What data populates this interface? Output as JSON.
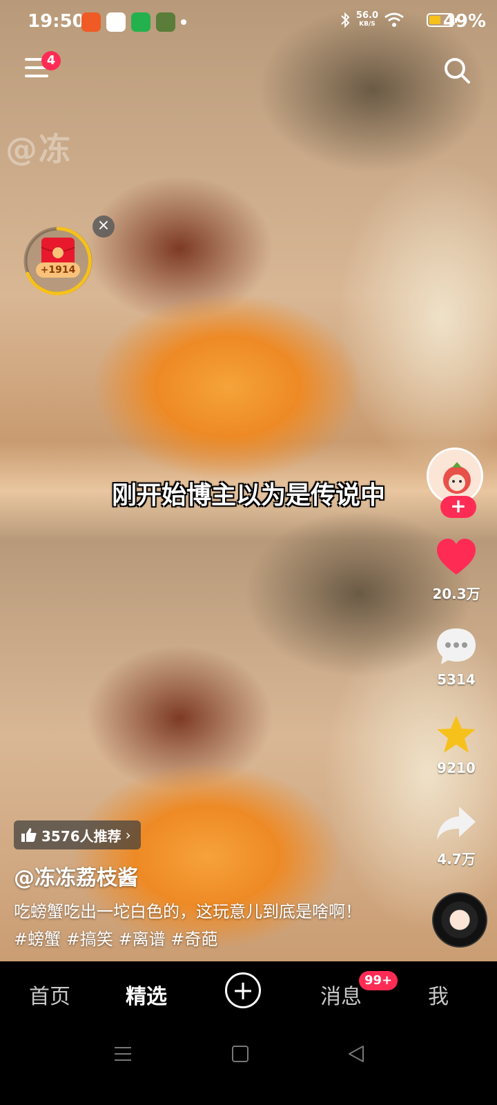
{
  "status_bar": {
    "time": "19:50",
    "net_speed_value": "56.0",
    "net_speed_unit": "KB/S",
    "battery_percent": "49%",
    "battery_level": 0.49,
    "icons": [
      "app-icon",
      "app-icon",
      "app-icon",
      "app-icon",
      "bluetooth-icon",
      "wifi-icon",
      "battery-icon"
    ]
  },
  "top": {
    "menu_badge": "4",
    "watermark": "@冻"
  },
  "red_packet": {
    "amount": "+1914"
  },
  "subtitle": "刚开始博主以为是传说中",
  "rail": {
    "follow_label": "+",
    "likes": "20.3万",
    "comments": "5314",
    "favorites": "9210",
    "shares": "4.7万"
  },
  "info": {
    "recommend": "3576人推荐",
    "author": "@冻冻荔枝酱",
    "description": "吃螃蟹吃出一坨白色的，这玩意儿到底是啥啊！#螃蟹 #搞笑 #离谱 #奇葩"
  },
  "tabs": {
    "home": "首页",
    "featured": "精选",
    "add": "+",
    "messages": "消息",
    "messages_badge": "99+",
    "me": "我"
  },
  "colors": {
    "accent": "#fe2c55",
    "like": "#fe2c55",
    "star": "#f6c11b"
  }
}
